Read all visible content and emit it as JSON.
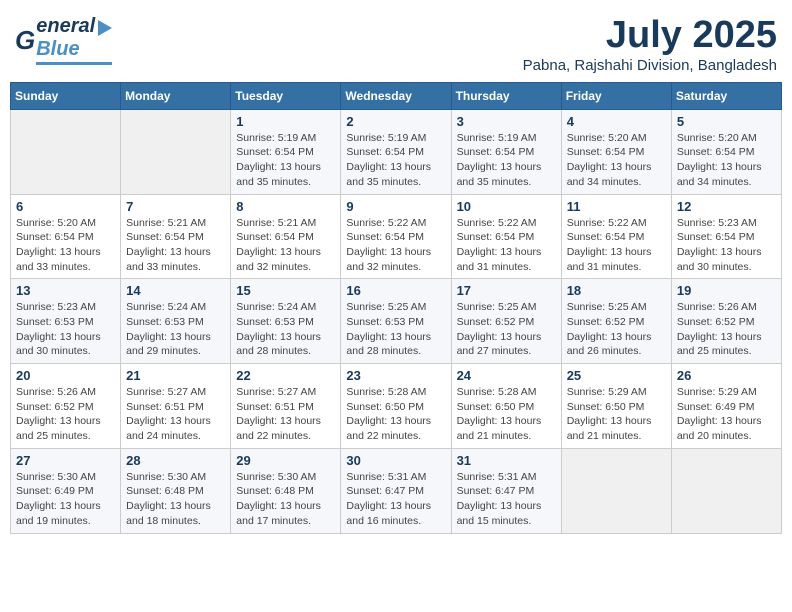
{
  "header": {
    "logo_general": "General",
    "logo_blue": "Blue",
    "title": "July 2025",
    "subtitle": "Pabna, Rajshahi Division, Bangladesh"
  },
  "calendar": {
    "weekdays": [
      "Sunday",
      "Monday",
      "Tuesday",
      "Wednesday",
      "Thursday",
      "Friday",
      "Saturday"
    ],
    "weeks": [
      [
        {
          "day": "",
          "detail": ""
        },
        {
          "day": "",
          "detail": ""
        },
        {
          "day": "1",
          "detail": "Sunrise: 5:19 AM\nSunset: 6:54 PM\nDaylight: 13 hours and 35 minutes."
        },
        {
          "day": "2",
          "detail": "Sunrise: 5:19 AM\nSunset: 6:54 PM\nDaylight: 13 hours and 35 minutes."
        },
        {
          "day": "3",
          "detail": "Sunrise: 5:19 AM\nSunset: 6:54 PM\nDaylight: 13 hours and 35 minutes."
        },
        {
          "day": "4",
          "detail": "Sunrise: 5:20 AM\nSunset: 6:54 PM\nDaylight: 13 hours and 34 minutes."
        },
        {
          "day": "5",
          "detail": "Sunrise: 5:20 AM\nSunset: 6:54 PM\nDaylight: 13 hours and 34 minutes."
        }
      ],
      [
        {
          "day": "6",
          "detail": "Sunrise: 5:20 AM\nSunset: 6:54 PM\nDaylight: 13 hours and 33 minutes."
        },
        {
          "day": "7",
          "detail": "Sunrise: 5:21 AM\nSunset: 6:54 PM\nDaylight: 13 hours and 33 minutes."
        },
        {
          "day": "8",
          "detail": "Sunrise: 5:21 AM\nSunset: 6:54 PM\nDaylight: 13 hours and 32 minutes."
        },
        {
          "day": "9",
          "detail": "Sunrise: 5:22 AM\nSunset: 6:54 PM\nDaylight: 13 hours and 32 minutes."
        },
        {
          "day": "10",
          "detail": "Sunrise: 5:22 AM\nSunset: 6:54 PM\nDaylight: 13 hours and 31 minutes."
        },
        {
          "day": "11",
          "detail": "Sunrise: 5:22 AM\nSunset: 6:54 PM\nDaylight: 13 hours and 31 minutes."
        },
        {
          "day": "12",
          "detail": "Sunrise: 5:23 AM\nSunset: 6:54 PM\nDaylight: 13 hours and 30 minutes."
        }
      ],
      [
        {
          "day": "13",
          "detail": "Sunrise: 5:23 AM\nSunset: 6:53 PM\nDaylight: 13 hours and 30 minutes."
        },
        {
          "day": "14",
          "detail": "Sunrise: 5:24 AM\nSunset: 6:53 PM\nDaylight: 13 hours and 29 minutes."
        },
        {
          "day": "15",
          "detail": "Sunrise: 5:24 AM\nSunset: 6:53 PM\nDaylight: 13 hours and 28 minutes."
        },
        {
          "day": "16",
          "detail": "Sunrise: 5:25 AM\nSunset: 6:53 PM\nDaylight: 13 hours and 28 minutes."
        },
        {
          "day": "17",
          "detail": "Sunrise: 5:25 AM\nSunset: 6:52 PM\nDaylight: 13 hours and 27 minutes."
        },
        {
          "day": "18",
          "detail": "Sunrise: 5:25 AM\nSunset: 6:52 PM\nDaylight: 13 hours and 26 minutes."
        },
        {
          "day": "19",
          "detail": "Sunrise: 5:26 AM\nSunset: 6:52 PM\nDaylight: 13 hours and 25 minutes."
        }
      ],
      [
        {
          "day": "20",
          "detail": "Sunrise: 5:26 AM\nSunset: 6:52 PM\nDaylight: 13 hours and 25 minutes."
        },
        {
          "day": "21",
          "detail": "Sunrise: 5:27 AM\nSunset: 6:51 PM\nDaylight: 13 hours and 24 minutes."
        },
        {
          "day": "22",
          "detail": "Sunrise: 5:27 AM\nSunset: 6:51 PM\nDaylight: 13 hours and 22 minutes."
        },
        {
          "day": "23",
          "detail": "Sunrise: 5:28 AM\nSunset: 6:50 PM\nDaylight: 13 hours and 22 minutes."
        },
        {
          "day": "24",
          "detail": "Sunrise: 5:28 AM\nSunset: 6:50 PM\nDaylight: 13 hours and 21 minutes."
        },
        {
          "day": "25",
          "detail": "Sunrise: 5:29 AM\nSunset: 6:50 PM\nDaylight: 13 hours and 21 minutes."
        },
        {
          "day": "26",
          "detail": "Sunrise: 5:29 AM\nSunset: 6:49 PM\nDaylight: 13 hours and 20 minutes."
        }
      ],
      [
        {
          "day": "27",
          "detail": "Sunrise: 5:30 AM\nSunset: 6:49 PM\nDaylight: 13 hours and 19 minutes."
        },
        {
          "day": "28",
          "detail": "Sunrise: 5:30 AM\nSunset: 6:48 PM\nDaylight: 13 hours and 18 minutes."
        },
        {
          "day": "29",
          "detail": "Sunrise: 5:30 AM\nSunset: 6:48 PM\nDaylight: 13 hours and 17 minutes."
        },
        {
          "day": "30",
          "detail": "Sunrise: 5:31 AM\nSunset: 6:47 PM\nDaylight: 13 hours and 16 minutes."
        },
        {
          "day": "31",
          "detail": "Sunrise: 5:31 AM\nSunset: 6:47 PM\nDaylight: 13 hours and 15 minutes."
        },
        {
          "day": "",
          "detail": ""
        },
        {
          "day": "",
          "detail": ""
        }
      ]
    ]
  }
}
